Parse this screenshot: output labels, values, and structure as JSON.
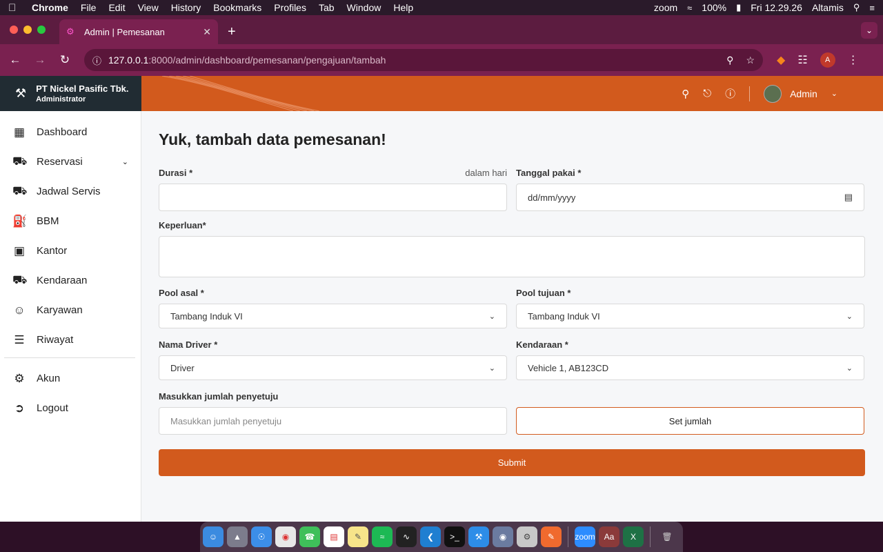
{
  "menubar": {
    "app": "Chrome",
    "menus": [
      "File",
      "Edit",
      "View",
      "History",
      "Bookmarks",
      "Profiles",
      "Tab",
      "Window",
      "Help"
    ],
    "zoom": "zoom",
    "battery": "100%",
    "clock": "Fri 12.29.26",
    "user": "Altamis"
  },
  "browser": {
    "tab_title": "Admin | Pemesanan",
    "url_host": "127.0.0.1",
    "url_path": ":8000/admin/dashboard/pemesanan/pengajuan/tambah",
    "profile_initial": "A"
  },
  "brand": {
    "company": "PT Nickel Pasific Tbk.",
    "role": "Administrator"
  },
  "topnav": {
    "username": "Admin"
  },
  "sidebar": {
    "items": [
      {
        "label": "Dashboard"
      },
      {
        "label": "Reservasi"
      },
      {
        "label": "Jadwal Servis"
      },
      {
        "label": "BBM"
      },
      {
        "label": "Kantor"
      },
      {
        "label": "Kendaraan"
      },
      {
        "label": "Karyawan"
      },
      {
        "label": "Riwayat"
      },
      {
        "label": "Akun"
      },
      {
        "label": "Logout"
      }
    ]
  },
  "form": {
    "title": "Yuk, tambah data pemesanan!",
    "durasi_label": "Durasi *",
    "durasi_hint": "dalam hari",
    "tanggal_label": "Tanggal pakai *",
    "tanggal_placeholder": "dd/mm/yyyy",
    "keperluan_label": "Keperluan*",
    "pool_asal_label": "Pool asal *",
    "pool_asal_value": "Tambang Induk VI",
    "pool_tujuan_label": "Pool tujuan *",
    "pool_tujuan_value": "Tambang Induk VI",
    "driver_label": "Nama Driver *",
    "driver_value": "Driver",
    "kendaraan_label": "Kendaraan *",
    "kendaraan_value": "Vehicle 1, AB123CD",
    "penyetuju_label": "Masukkan jumlah penyetuju",
    "penyetuju_placeholder": "Masukkan jumlah penyetuju",
    "set_jumlah_label": "Set jumlah",
    "submit_label": "Submit"
  },
  "colors": {
    "accent": "#d25a1d",
    "brand_bg": "#212c33",
    "browser_bg": "#7a2150"
  }
}
